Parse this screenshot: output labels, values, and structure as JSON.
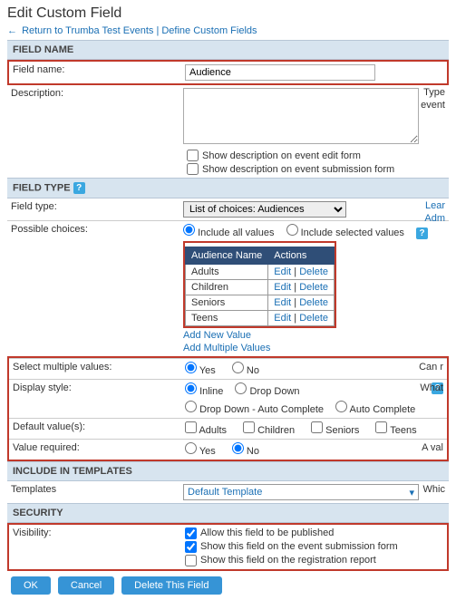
{
  "title": "Edit Custom Field",
  "nav": {
    "back": "Return to Trumba Test Events",
    "define": "Define Custom Fields",
    "sep": " | "
  },
  "sections": {
    "fieldName": "FIELD NAME",
    "fieldType": "FIELD TYPE",
    "includeIn": "INCLUDE IN TEMPLATES",
    "security": "SECURITY"
  },
  "labels": {
    "fieldName": "Field name:",
    "description": "Description:",
    "fieldType": "Field type:",
    "possibleChoices": "Possible choices:",
    "selectMultiple": "Select multiple values:",
    "displayStyle": "Display style:",
    "defaultValues": "Default value(s):",
    "valueRequired": "Value required:",
    "templates": "Templates",
    "visibility": "Visibility:"
  },
  "fieldName": "Audience",
  "description": "",
  "descOptions": {
    "showOnEdit": "Show description on event edit form",
    "showOnSubmission": "Show description on event submission form"
  },
  "fieldTypeValue": "List of choices: Audiences",
  "rightHints": {
    "typeEvent": "Type",
    "typeEvent2": "event",
    "learn": "Lear",
    "admin": "Adm",
    "canR": "Can r",
    "what": "What",
    "aVal": "A val",
    "which": "Whic"
  },
  "choices": {
    "includeAll": "Include all values",
    "includeSelected": "Include selected values",
    "headers": {
      "name": "Audience Name",
      "actions": "Actions"
    },
    "rows": [
      "Adults",
      "Children",
      "Seniors",
      "Teens"
    ],
    "edit": "Edit",
    "delete": "Delete",
    "addNew": "Add New Value",
    "addMulti": "Add Multiple Values"
  },
  "yesNo": {
    "yes": "Yes",
    "no": "No"
  },
  "displayStyle": {
    "inline": "Inline",
    "dropdown": "Drop Down",
    "dropdownAuto": "Drop Down - Auto Complete",
    "auto": "Auto Complete"
  },
  "defaultChoices": [
    "Adults",
    "Children",
    "Seniors",
    "Teens"
  ],
  "templateValue": "Default Template",
  "visibility": {
    "publish": "Allow this field to be published",
    "showSubmission": "Show this field on the event submission form",
    "showRegistration": "Show this field on the registration report"
  },
  "buttons": {
    "ok": "OK",
    "cancel": "Cancel",
    "delete": "Delete This Field"
  }
}
